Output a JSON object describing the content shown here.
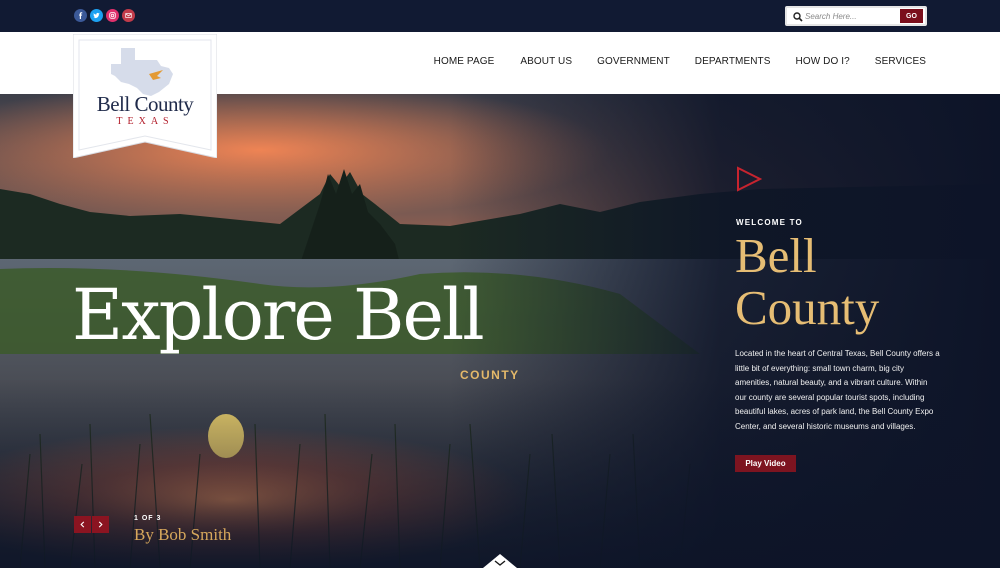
{
  "topbar": {
    "social": [
      "facebook-icon",
      "twitter-icon",
      "instagram-icon",
      "email-icon"
    ],
    "search_placeholder": "Search Here...",
    "search_button": "GO"
  },
  "logo": {
    "name": "Bell County",
    "state": "TEXAS"
  },
  "nav": [
    "HOME PAGE",
    "ABOUT US",
    "GOVERNMENT",
    "DEPARTMENTS",
    "HOW DO I?",
    "SERVICES"
  ],
  "hero": {
    "headline": "Explore Bell",
    "headline_sub": "COUNTY",
    "welcome": "WELCOME TO",
    "title": "Bell County",
    "description": "Located in the heart of Central Texas, Bell County offers a little bit of everything:  small town charm, big city amenities, natural beauty, and a vibrant culture.  Within our county are several popular tourist spots, including beautiful lakes, acres of park land, the Bell County Expo Center, and several historic museums and villages.",
    "play_button": "Play Video",
    "slide_counter": "1 OF 3",
    "byline": "By Bob Smith"
  },
  "colors": {
    "navy": "#111a33",
    "accent_red": "#7b0f1c",
    "gold": "#e6bd74",
    "facebook": "#3b5998",
    "twitter": "#1da1f2",
    "instagram": "#e1306c",
    "email": "#c13b4a"
  }
}
